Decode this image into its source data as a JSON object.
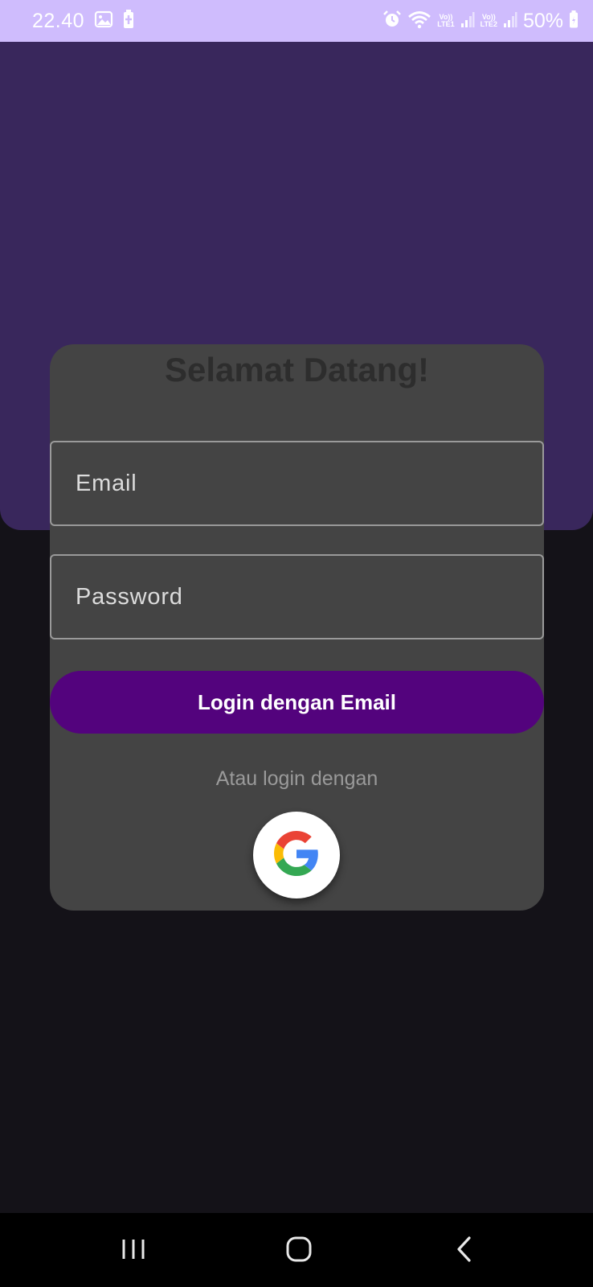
{
  "status_bar": {
    "time": "22.40",
    "battery_percent": "50%",
    "sim1_label": "LTE1",
    "sim2_label": "LTE2",
    "volte_label": "Vo))",
    "icons": [
      "gallery-icon",
      "battery-saver-icon",
      "alarm-icon",
      "wifi-icon",
      "signal-icon",
      "battery-icon"
    ]
  },
  "login_card": {
    "title": "Selamat Datang!",
    "email_placeholder": "Email",
    "password_placeholder": "Password",
    "login_button_label": "Login dengan Email",
    "alternative_text": "Atau login dengan",
    "google_icon": "google-logo"
  },
  "nav_bar": {
    "icons": [
      "recents-icon",
      "home-icon",
      "back-icon"
    ]
  },
  "colors": {
    "status_bar_bg": "#cfbcfd",
    "banner_bg": "#39275c",
    "page_bg": "#141218",
    "card_bg": "#444444",
    "button_bg": "#53037d"
  }
}
